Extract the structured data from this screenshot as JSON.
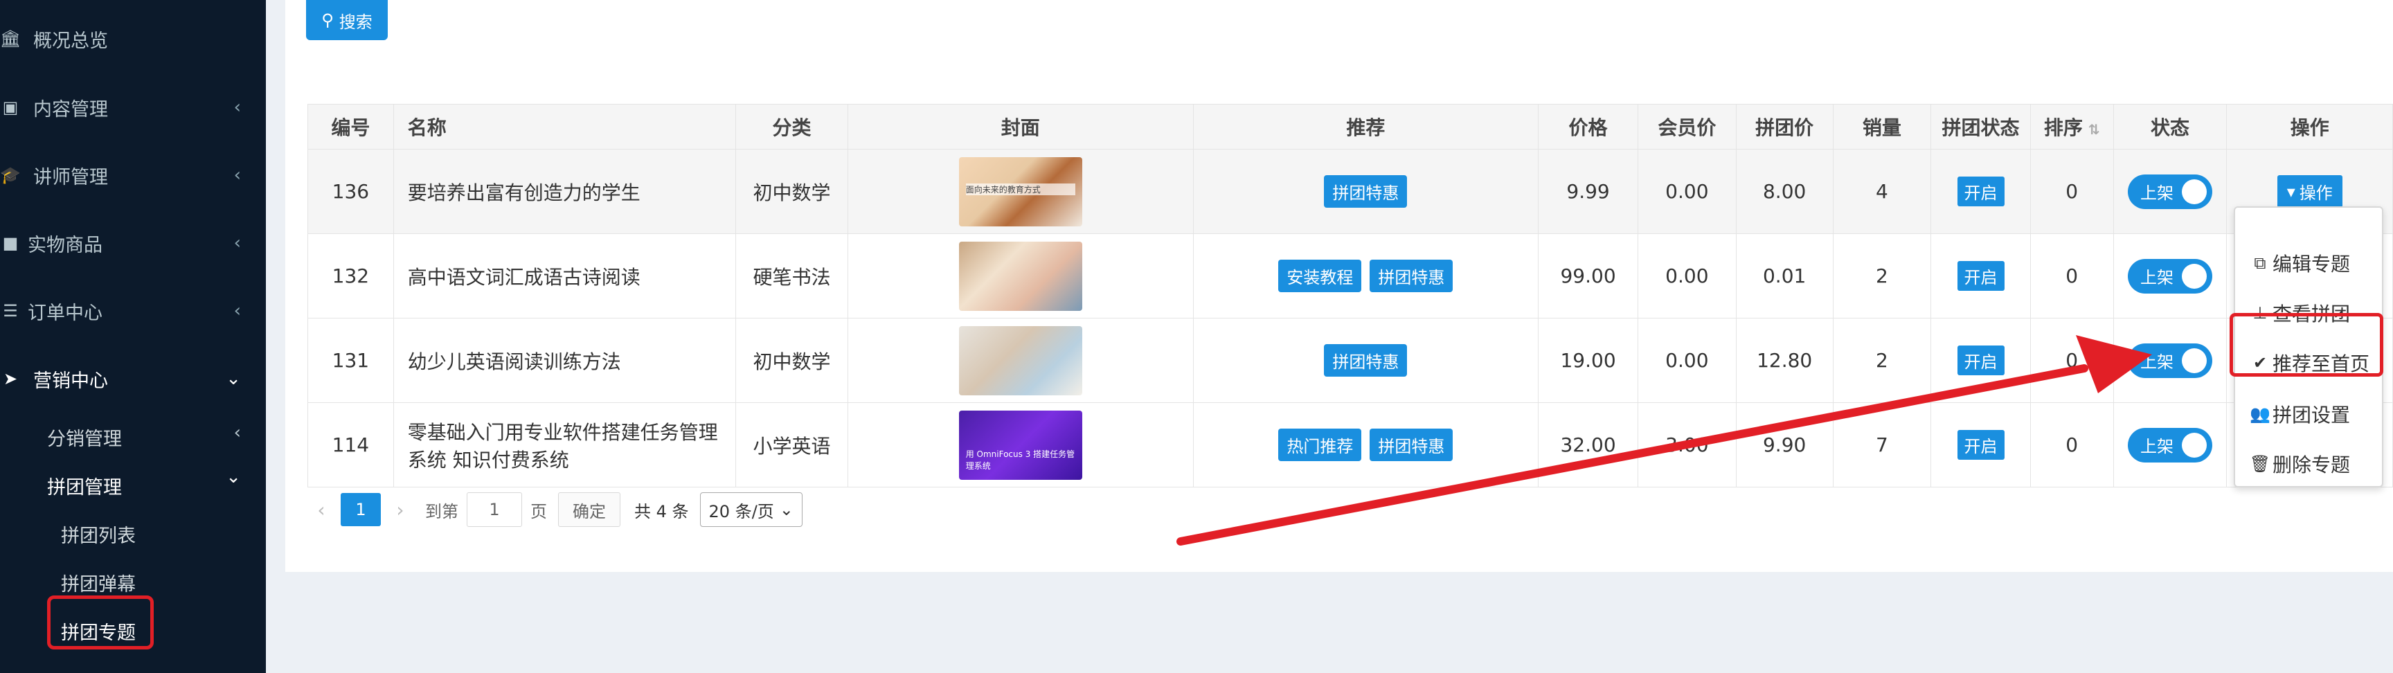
{
  "sidebar": {
    "items": [
      {
        "label": "概况总览",
        "icon": "bank-icon"
      },
      {
        "label": "内容管理",
        "icon": "image-icon"
      },
      {
        "label": "讲师管理",
        "icon": "graduation-cap-icon"
      },
      {
        "label": "实物商品",
        "icon": "gift-icon"
      },
      {
        "label": "订单中心",
        "icon": "list-icon"
      },
      {
        "label": "营销中心",
        "icon": "paper-plane-icon"
      }
    ],
    "sub": {
      "fenxiao": "分销管理",
      "pintuan": "拼团管理",
      "pintuan_list": "拼团列表",
      "pintuan_popup": "拼团弹幕",
      "pintuan_topic": "拼团专题"
    }
  },
  "toolbar": {
    "search_label": "搜索"
  },
  "table": {
    "headers": {
      "id": "编号",
      "name": "名称",
      "category": "分类",
      "cover": "封面",
      "recommend": "推荐",
      "price": "价格",
      "member_price": "会员价",
      "group_price": "拼团价",
      "sales": "销量",
      "group_status": "拼团状态",
      "sort": "排序",
      "status": "状态",
      "action": "操作"
    },
    "rows": [
      {
        "id": "136",
        "name": "要培养出富有创造力的学生",
        "category": "初中数学",
        "cover_text": "面向未来的教育方式",
        "tags": [
          "拼团特惠"
        ],
        "price": "9.99",
        "member_price": "0.00",
        "group_price": "8.00",
        "sales": "4",
        "group_status": "开启",
        "sort": "0",
        "status": "上架"
      },
      {
        "id": "132",
        "name": "高中语文词汇成语古诗阅读",
        "category": "硬笔书法",
        "cover_text": "",
        "tags": [
          "安装教程",
          "拼团特惠"
        ],
        "price": "99.00",
        "member_price": "0.00",
        "group_price": "0.01",
        "sales": "2",
        "group_status": "开启",
        "sort": "0",
        "status": "上架"
      },
      {
        "id": "131",
        "name": "幼少儿英语阅读训练方法",
        "category": "初中数学",
        "cover_text": "",
        "tags": [
          "拼团特惠"
        ],
        "price": "19.00",
        "member_price": "0.00",
        "group_price": "12.80",
        "sales": "2",
        "group_status": "开启",
        "sort": "0",
        "status": "上架"
      },
      {
        "id": "114",
        "name": "零基础入门用专业软件搭建任务管理系统 知识付费系统",
        "category": "小学英语",
        "cover_text": "用 OmniFocus 3 搭建任务管理系统",
        "tags": [
          "热门推荐",
          "拼团特惠"
        ],
        "price": "32.00",
        "member_price": "3.00",
        "group_price": "9.90",
        "sales": "7",
        "group_status": "开启",
        "sort": "0",
        "status": "上架"
      }
    ],
    "action_label": "操作"
  },
  "dropdown": {
    "items": [
      {
        "label": "编辑专题",
        "icon": "copy-icon"
      },
      {
        "label": "查看拼团",
        "icon": "stamp-icon"
      },
      {
        "label": "推荐至首页",
        "icon": "check-circle-icon"
      },
      {
        "label": "拼团设置",
        "icon": "users-icon"
      },
      {
        "label": "删除专题",
        "icon": "trash-icon"
      }
    ]
  },
  "pagination": {
    "current_page": "1",
    "goto_label": "到第",
    "goto_value": "1",
    "page_unit": "页",
    "confirm_label": "确定",
    "total_text": "共 4 条",
    "page_size": "20 条/页"
  },
  "colors": {
    "accent": "#1a8fdf",
    "sidebar_bg": "#0c1a2b",
    "highlight": "#e21f26"
  }
}
